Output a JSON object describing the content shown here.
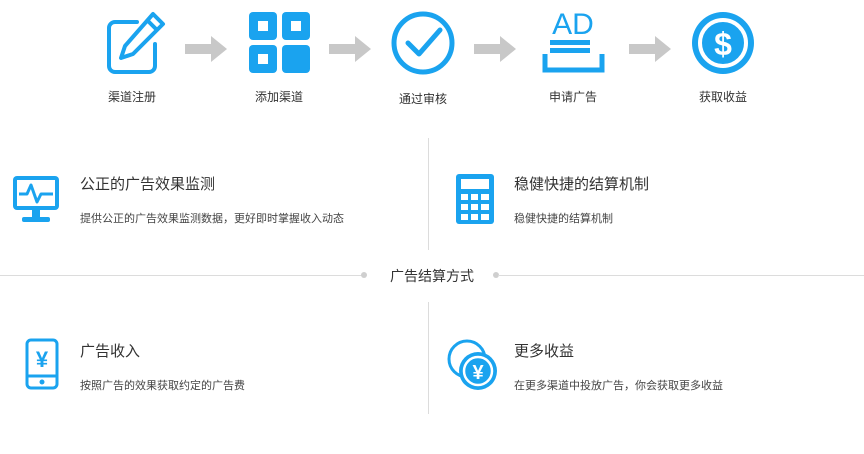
{
  "colors": {
    "accent": "#1aa3ef",
    "arrow": "#c8c8c8",
    "line": "#dcdcdc"
  },
  "steps": [
    {
      "label": "渠道注册",
      "icon": "edit-icon"
    },
    {
      "label": "添加渠道",
      "icon": "grid-icon"
    },
    {
      "label": "通过审核",
      "icon": "check-circle-icon"
    },
    {
      "label": "申请广告",
      "icon": "ad-icon",
      "icon_text": "AD"
    },
    {
      "label": "获取收益",
      "icon": "dollar-icon",
      "icon_text": "$"
    }
  ],
  "features": [
    {
      "title": "公正的广告效果监测",
      "desc": "提供公正的广告效果监测数据，更好即时掌握收入动态",
      "icon": "monitor-icon"
    },
    {
      "title": "稳健快捷的结算机制",
      "desc": "稳健快捷的结算机制",
      "icon": "calculator-icon"
    },
    {
      "title": "广告收入",
      "desc": "按照广告的效果获取约定的广告费",
      "icon": "phone-yuan-icon",
      "icon_text": "¥"
    },
    {
      "title": "更多收益",
      "desc": "在更多渠道中投放广告，你会获取更多收益",
      "icon": "coins-icon",
      "icon_text": "¥"
    }
  ],
  "divider": {
    "label": "广告结算方式"
  }
}
